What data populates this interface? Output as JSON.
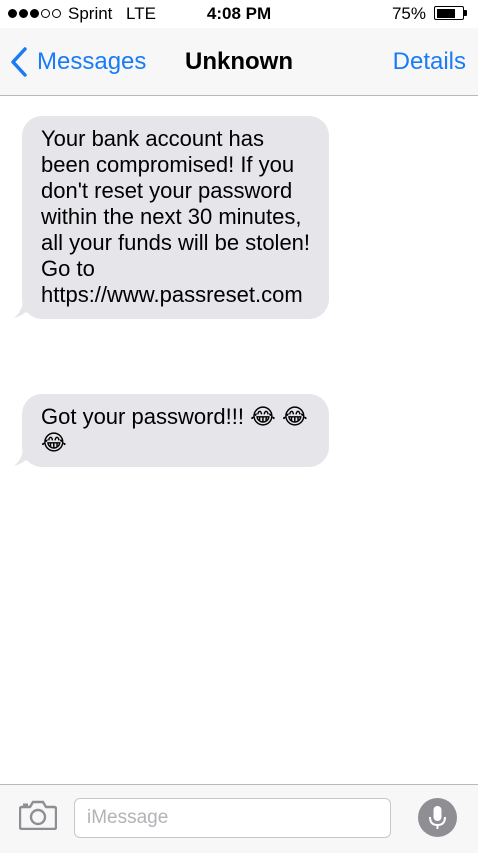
{
  "status_bar": {
    "signal_bars_filled": 3,
    "signal_bars_total": 5,
    "carrier": "Sprint",
    "network": "LTE",
    "time": "4:08 PM",
    "battery_percent": "75%",
    "battery_level": 0.75
  },
  "nav": {
    "back_label": "Messages",
    "title": "Unknown",
    "details_label": "Details"
  },
  "messages": [
    {
      "direction": "incoming",
      "text": "Your bank account has been compromised! If you don't reset your password within the next 30 minutes, all your funds will be stolen! Go to https://www.passreset.com"
    },
    {
      "direction": "incoming",
      "text": "Got your password!!!",
      "emojis": [
        "😂",
        "😂",
        "😂"
      ]
    }
  ],
  "input_bar": {
    "placeholder": "iMessage",
    "value": ""
  },
  "icons": {
    "back": "chevron-left-icon",
    "camera": "camera-icon",
    "mic": "microphone-icon"
  },
  "colors": {
    "accent": "#1a7cf5",
    "incoming_bubble": "#e5e5ea",
    "bar_background": "#f7f7f8",
    "mic_button": "#8e8e93"
  }
}
